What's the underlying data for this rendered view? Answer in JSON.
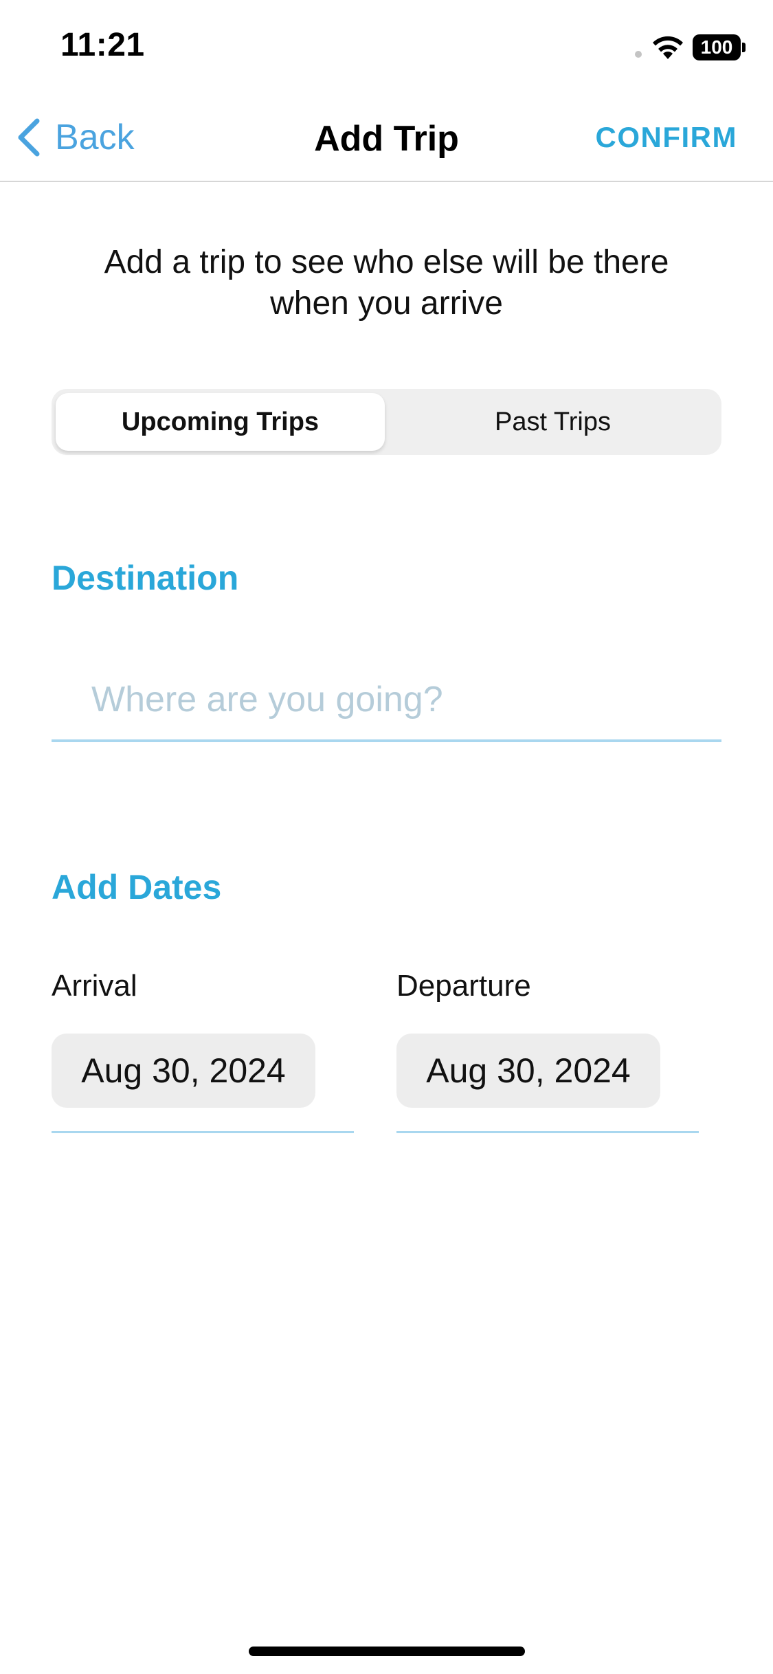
{
  "status_bar": {
    "time": "11:21",
    "battery": "100"
  },
  "nav": {
    "back_label": "Back",
    "title": "Add Trip",
    "confirm_label": "CONFIRM"
  },
  "intro_text": "Add a trip to see who else will be there when you arrive",
  "tabs": [
    {
      "label": "Upcoming Trips",
      "selected": true
    },
    {
      "label": "Past Trips",
      "selected": false
    }
  ],
  "destination": {
    "label": "Destination",
    "placeholder": "Where are you going?",
    "value": ""
  },
  "dates": {
    "label": "Add Dates",
    "arrival": {
      "caption": "Arrival",
      "value": "Aug 30, 2024"
    },
    "departure": {
      "caption": "Departure",
      "value": "Aug 30, 2024"
    }
  },
  "colors": {
    "accent": "#2aa7d9",
    "back_link": "#4aa3df",
    "underline": "#a9d7ef",
    "placeholder": "#b5ccd9"
  }
}
